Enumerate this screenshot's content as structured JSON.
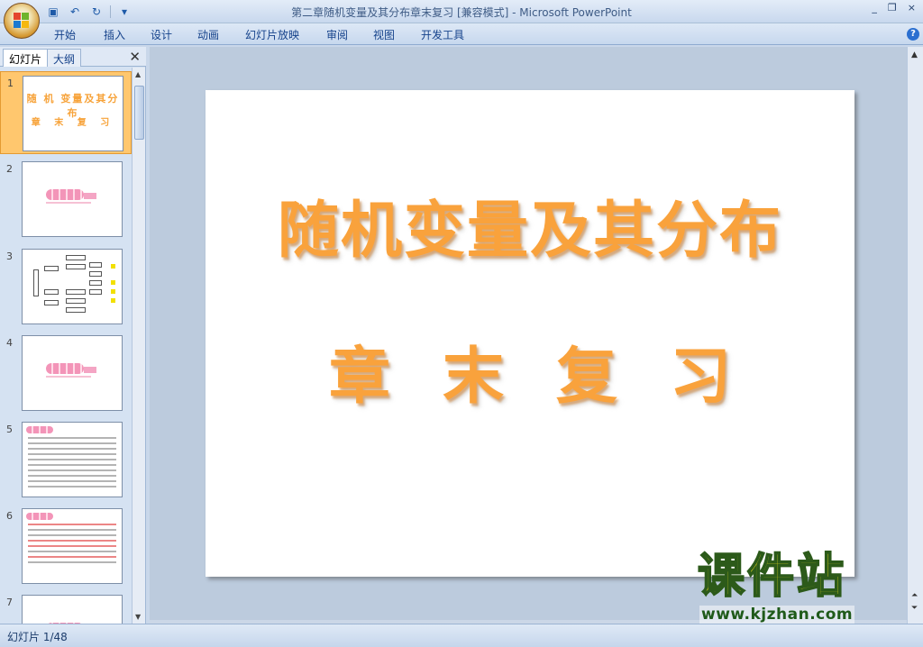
{
  "window": {
    "title": "第二章随机变量及其分布章末复习 [兼容模式] - Microsoft PowerPoint",
    "controls": [
      "_",
      "❐",
      "×"
    ]
  },
  "qat": {
    "save_icon": "save-icon",
    "undo_icon": "undo-icon",
    "redo_icon": "redo-icon"
  },
  "ribbon": {
    "tabs": [
      "开始",
      "插入",
      "设计",
      "动画",
      "幻灯片放映",
      "审阅",
      "视图",
      "开发工具"
    ],
    "help": "?"
  },
  "left_pane": {
    "tab_slides": "幻灯片",
    "tab_outline": "大纲",
    "close": "✕",
    "thumbnails": [
      {
        "num": "1",
        "line1": "随 机 变量及其分布",
        "line2": "章 末 复 习"
      },
      {
        "num": "2"
      },
      {
        "num": "3"
      },
      {
        "num": "4"
      },
      {
        "num": "5"
      },
      {
        "num": "6"
      },
      {
        "num": "7"
      }
    ]
  },
  "slide": {
    "title": "随机变量及其分布",
    "subtitle": "章末复习"
  },
  "watermark": {
    "brand": "课件站",
    "url": "www.kjzhan.com"
  },
  "status": {
    "slide_count": "幻灯片 1/48"
  }
}
